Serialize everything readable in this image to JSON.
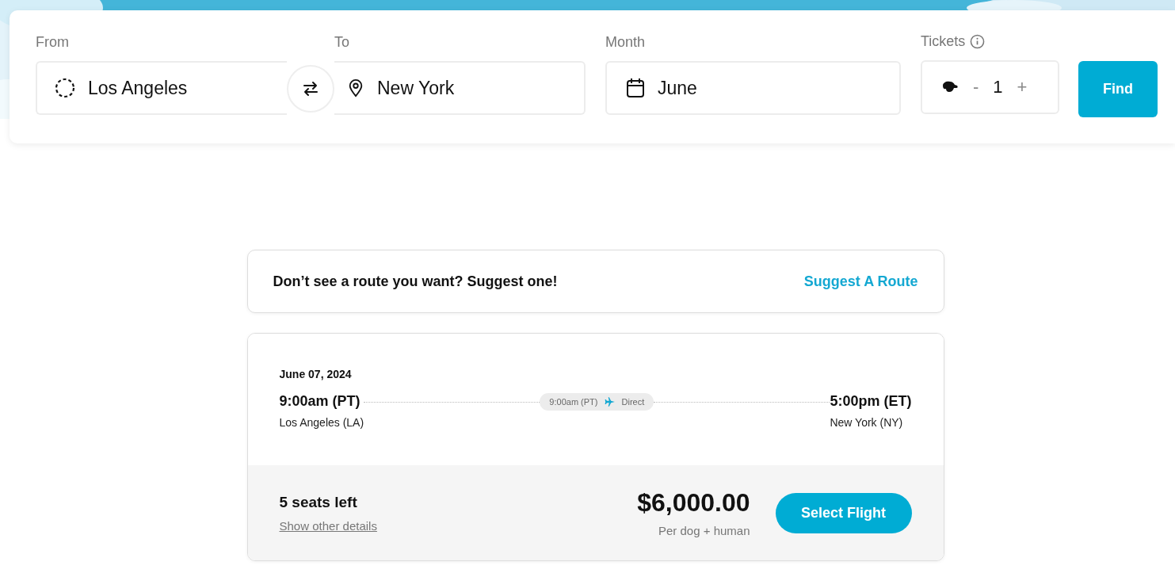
{
  "search": {
    "from": {
      "label": "From",
      "value": "Los Angeles"
    },
    "to": {
      "label": "To",
      "value": "New York"
    },
    "month": {
      "label": "Month",
      "value": "June"
    },
    "tickets": {
      "label": "Tickets",
      "minus": "-",
      "count": "1",
      "plus": "+"
    },
    "find_button": "Find"
  },
  "suggestion": {
    "text": "Don’t see a route you want? Suggest one!",
    "link": "Suggest A Route"
  },
  "flight": {
    "date": "June 07, 2024",
    "departure": {
      "time": "9:00am (PT)",
      "city": "Los Angeles (LA)"
    },
    "stop": {
      "time": "9:00am (PT)",
      "label": "Direct"
    },
    "arrival": {
      "time": "5:00pm (ET)",
      "city": "New York (NY)"
    },
    "seats": "5 seats left",
    "details_link": "Show other details",
    "price": "$6,000.00",
    "price_note": "Per dog + human",
    "select_button": "Select Flight"
  }
}
